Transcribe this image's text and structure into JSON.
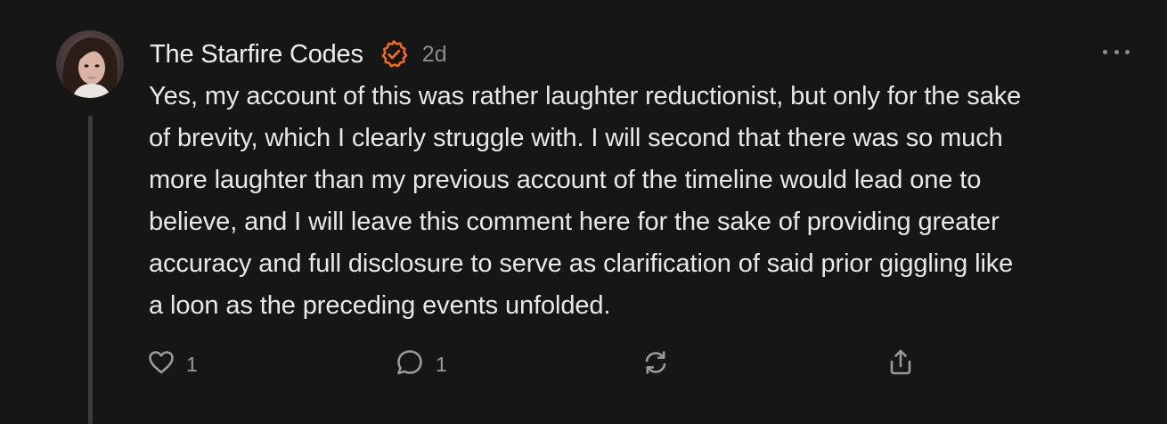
{
  "comment": {
    "author": "The Starfire Codes",
    "timestamp": "2d",
    "body_lines": [
      "Yes, my account of this was rather laughter reductionist, but only for the sake",
      "of brevity, which I clearly struggle with. I will second that there was so much",
      "more laughter than my previous account of the timeline would lead one to",
      "believe, and I will leave this comment here for the sake of providing greater",
      "accuracy and full disclosure to serve as clarification of said prior giggling like",
      "a loon as the preceding events unfolded."
    ],
    "verified_badge_color": "#f06a22",
    "actions": {
      "like_icon": "heart-icon",
      "like_count": "1",
      "reply_icon": "comment-bubble-icon",
      "reply_count": "1",
      "restack_icon": "restack-icon",
      "share_icon": "share-icon"
    }
  },
  "colors": {
    "background": "#161616",
    "text": "#e8e8e8",
    "muted": "#8a8a8a",
    "thread_line": "#3c3c3c"
  }
}
